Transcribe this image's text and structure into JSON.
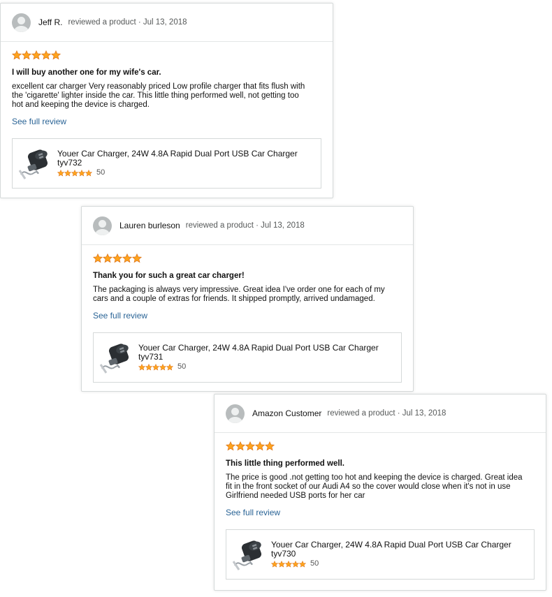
{
  "reviews": [
    {
      "author": "Jeff R.",
      "meta": "reviewed a product · Jul 13, 2018",
      "rating": 5,
      "title": "I will buy another one for my wife's car.",
      "lines": [
        "excellent car charger Very reasonably priced Low profile charger that fits flush with",
        "the 'cigarette' lighter inside the car. This little thing performed well, not getting too",
        "hot and keeping the device is charged."
      ],
      "link": "See full review",
      "product": {
        "name": "Youer Car Charger, 24W 4.8A Rapid Dual Port USB Car Charger",
        "sku": "tyv732",
        "stars": 5,
        "count": "50"
      }
    },
    {
      "author": "Lauren burleson",
      "meta": "reviewed a product · Jul 13, 2018",
      "rating": 5,
      "title": "Thank you for such a great car charger!",
      "lines": [
        "The packaging is always very impressive. Great idea I've order one for each of my",
        "cars and a couple of extras for friends. It shipped promptly, arrived undamaged."
      ],
      "link": "See full review",
      "product": {
        "name": "Youer Car Charger, 24W 4.8A Rapid Dual Port USB Car Charger",
        "sku": "tyv731",
        "stars": 5,
        "count": "50"
      }
    },
    {
      "author": "Amazon Customer",
      "meta": "reviewed a product · Jul 13, 2018",
      "rating": 5,
      "title": "This little thing performed well.",
      "lines": [
        "The price is good .not getting too hot and keeping the device is charged. Great idea",
        "fit in the front socket of our Audi A4 so the cover would close when it's not in use",
        "Girlfriend needed USB ports for her car"
      ],
      "link": "See full review",
      "product": {
        "name": "Youer Car Charger, 24W 4.8A Rapid Dual Port USB Car Charger",
        "sku": "tyv730",
        "stars": 5,
        "count": "50"
      }
    }
  ],
  "colors": {
    "star": "#ffa41c",
    "star_outline": "#de7921",
    "link": "#2a6496"
  },
  "icons": {
    "avatar": "user-avatar-icon",
    "star": "star-icon",
    "thumb": "car-charger-thumbnail"
  }
}
